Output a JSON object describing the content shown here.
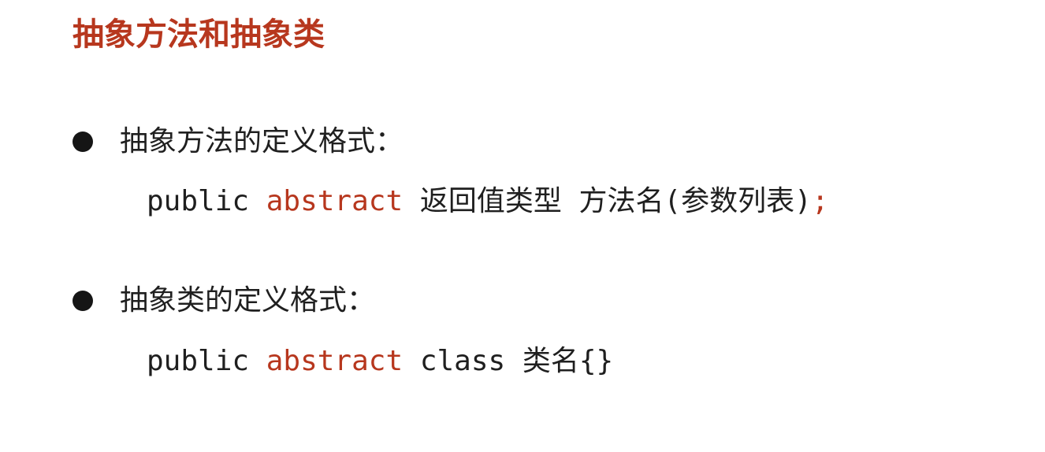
{
  "colors": {
    "accent": "#b7371e",
    "text": "#1f1f1f",
    "keyword": "#b7371e",
    "bullet": "#151515"
  },
  "title": "抽象方法和抽象类",
  "sections": [
    {
      "heading": "抽象方法的定义格式：",
      "code": {
        "kw_public": "public",
        "kw_abstract": "abstract",
        "rest": "返回值类型 方法名(参数列表)",
        "terminator": ";"
      }
    },
    {
      "heading": "抽象类的定义格式：",
      "code": {
        "kw_public": "public",
        "kw_abstract": "abstract",
        "rest": "class 类名{}"
      }
    }
  ]
}
